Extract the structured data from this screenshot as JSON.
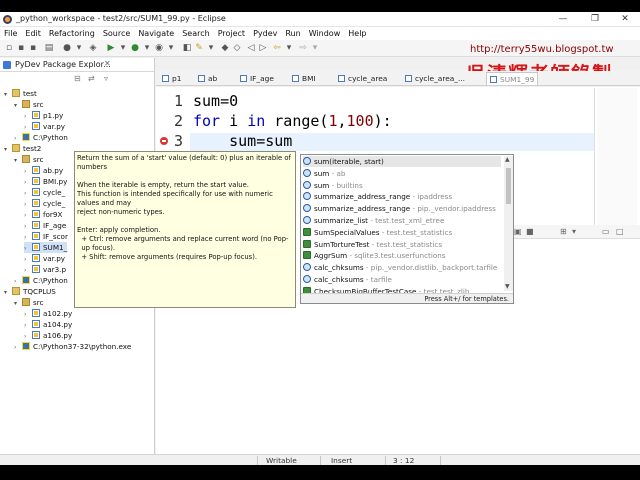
{
  "window": {
    "title": "_python_workspace - test2/src/SUM1_99.py - Eclipse",
    "minimize": "—",
    "maximize": "❐",
    "close": "✕"
  },
  "menu": [
    "File",
    "Edit",
    "Refactoring",
    "Source",
    "Navigate",
    "Search",
    "Project",
    "Pydev",
    "Run",
    "Window",
    "Help"
  ],
  "watermark": {
    "url": "http://terry55wu.blogspot.tw",
    "logo": "吳清輝老師錄製"
  },
  "explorer": {
    "tab_label": "PyDev Package Explor...",
    "close": "✕",
    "tree": [
      {
        "label": "test",
        "type": "project",
        "level": 0,
        "expanded": true
      },
      {
        "label": "src",
        "type": "folder",
        "level": 1,
        "expanded": true
      },
      {
        "label": "p1.py",
        "type": "py",
        "level": 2
      },
      {
        "label": "var.py",
        "type": "py",
        "level": 2
      },
      {
        "label": "C:\\Python",
        "type": "interp",
        "level": 1
      },
      {
        "label": "test2",
        "type": "project",
        "level": 0,
        "expanded": true
      },
      {
        "label": "src",
        "type": "folder",
        "level": 1,
        "expanded": true
      },
      {
        "label": "ab.py",
        "type": "py",
        "level": 2
      },
      {
        "label": "BMI.py",
        "type": "py",
        "level": 2
      },
      {
        "label": "cycle_",
        "type": "py",
        "level": 2
      },
      {
        "label": "cycle_",
        "type": "py",
        "level": 2
      },
      {
        "label": "for9X",
        "type": "py",
        "level": 2
      },
      {
        "label": "IF_age",
        "type": "py",
        "level": 2
      },
      {
        "label": "IF_scor",
        "type": "py",
        "level": 2
      },
      {
        "label": "SUM1_",
        "type": "py",
        "level": 2,
        "selected": true
      },
      {
        "label": "var.py",
        "type": "py",
        "level": 2
      },
      {
        "label": "var3.p",
        "type": "py",
        "level": 2
      },
      {
        "label": "C:\\Python",
        "type": "interp",
        "level": 1
      },
      {
        "label": "TQCPLUS",
        "type": "project",
        "level": 0,
        "expanded": true
      },
      {
        "label": "src",
        "type": "folder",
        "level": 1,
        "expanded": true
      },
      {
        "label": "a102.py",
        "type": "py",
        "level": 2
      },
      {
        "label": "a104.py",
        "type": "py",
        "level": 2
      },
      {
        "label": "a106.py",
        "type": "py",
        "level": 2
      },
      {
        "label": "C:\\Python37-32\\python.exe",
        "type": "interp",
        "level": 1
      }
    ]
  },
  "editor_tabs": [
    "p1",
    "ab",
    "IF_age",
    "BMI",
    "cycle_area",
    "cycle_area_...",
    "SUM1_99"
  ],
  "code": {
    "lines": [
      {
        "num": "1",
        "parts": [
          {
            "t": "sum=0",
            "c": ""
          }
        ]
      },
      {
        "num": "2",
        "parts": [
          {
            "t": "for",
            "c": "kw"
          },
          {
            "t": " i ",
            "c": ""
          },
          {
            "t": "in",
            "c": "kw"
          },
          {
            "t": " range(",
            "c": ""
          },
          {
            "t": "1",
            "c": "num"
          },
          {
            "t": ",",
            "c": ""
          },
          {
            "t": "100",
            "c": "num"
          },
          {
            "t": "):",
            "c": ""
          }
        ]
      },
      {
        "num": "3",
        "parts": [
          {
            "t": "    sum=sum",
            "c": ""
          }
        ]
      }
    ]
  },
  "doc_popup": {
    "lines": [
      "Return the sum of a 'start' value (default: 0) plus an iterable of",
      "numbers",
      "",
      "When the iterable is empty, return the start value.",
      "This function is intended specifically for use with numeric",
      "values and may",
      "reject non-numeric types.",
      "",
      "Enter: apply completion.",
      "  + Ctrl: remove arguments and replace current word (no Pop-",
      "  up focus).",
      "  + Shift: remove arguments (requires Pop-up focus)."
    ]
  },
  "completion": {
    "items": [
      {
        "name": "sum(iterable, start)",
        "src": "",
        "kind": "fn",
        "selected": true
      },
      {
        "name": "sum",
        "src": " - ab",
        "kind": "fn"
      },
      {
        "name": "sum",
        "src": " - builtins",
        "kind": "fn"
      },
      {
        "name": "summarize_address_range",
        "src": " - ipaddress",
        "kind": "fn"
      },
      {
        "name": "summarize_address_range",
        "src": " - pip._vendor.ipaddress",
        "kind": "fn"
      },
      {
        "name": "summarize_list",
        "src": " - test.test_xml_etree",
        "kind": "fn"
      },
      {
        "name": "SumSpecialValues",
        "src": " - test.test_statistics",
        "kind": "cls"
      },
      {
        "name": "SumTortureTest",
        "src": " - test.test_statistics",
        "kind": "cls"
      },
      {
        "name": "AggrSum",
        "src": " - sqlite3.test.userfunctions",
        "kind": "cls"
      },
      {
        "name": "calc_chksums",
        "src": " - pip._vendor.distlib._backport.tarfile",
        "kind": "fn"
      },
      {
        "name": "calc_chksums",
        "src": " - tarfile",
        "kind": "fn"
      },
      {
        "name": "ChecksumBigBufferTestCase",
        "src": " - test.test_zlib",
        "kind": "cls"
      }
    ],
    "footer": "Press Alt+/ for templates."
  },
  "status": {
    "writable": "Writable",
    "insert": "Insert",
    "position": "3 : 12"
  }
}
